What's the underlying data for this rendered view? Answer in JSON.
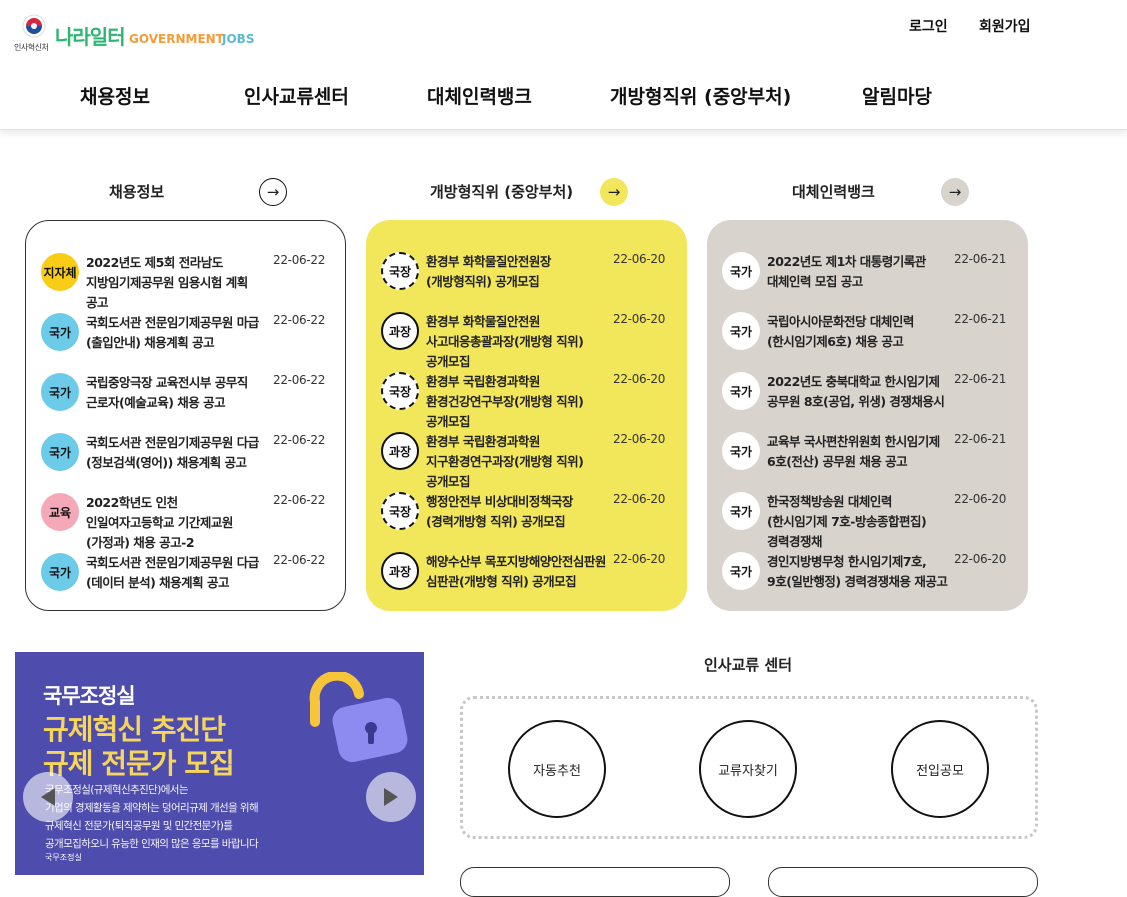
{
  "header": {
    "ministry": "인사혁신처",
    "logo_main": "나라일터",
    "logo_sub1": "GOVERNMENT",
    "logo_sub2": "JOBS",
    "login": "로그인",
    "signup": "회원가입",
    "nav": [
      "채용정보",
      "인사교류센터",
      "대체인력뱅크",
      "개방형직위 (중앙부처)",
      "알림마당"
    ]
  },
  "sections": {
    "recruit": {
      "title": "채용정보",
      "items": [
        {
          "badge": "지자체",
          "title": "2022년도 제5회 전라남도 지방임기제공무원 임용시험 계획 공고",
          "date": "22-06-22"
        },
        {
          "badge": "국가",
          "title": "국회도서관 전문임기제공무원 마급(출입안내) 채용계획 공고",
          "date": "22-06-22"
        },
        {
          "badge": "국가",
          "title": "국립중앙극장 교육전시부 공무직 근로자(예술교육) 채용 공고",
          "date": "22-06-22"
        },
        {
          "badge": "국가",
          "title": "국회도서관 전문임기제공무원 다급(정보검색(영어)) 채용계획 공고",
          "date": "22-06-22"
        },
        {
          "badge": "교육",
          "title": "2022학년도 인천 인일여자고등학교 기간제교원 (가정과) 채용 공고-2",
          "date": "22-06-22"
        },
        {
          "badge": "국가",
          "title": "국회도서관 전문임기제공무원 다급(데이터 분석) 채용계획 공고",
          "date": "22-06-22"
        }
      ]
    },
    "open": {
      "title": "개방형직위 (중앙부처)",
      "items": [
        {
          "badge": "국장",
          "title": "환경부 화학물질안전원장(개방형직위) 공개모집",
          "date": "22-06-20"
        },
        {
          "badge": "과장",
          "title": "환경부 화학물질안전원 사고대응총괄과장(개방형 직위) 공개모집",
          "date": "22-06-20"
        },
        {
          "badge": "국장",
          "title": "환경부 국립환경과학원 환경건강연구부장(개방형 직위) 공개모집",
          "date": "22-06-20"
        },
        {
          "badge": "과장",
          "title": "환경부 국립환경과학원 지구환경연구과장(개방형 직위) 공개모집",
          "date": "22-06-20"
        },
        {
          "badge": "국장",
          "title": "행정안전부 비상대비정책국장(경력개방형 직위) 공개모집",
          "date": "22-06-20"
        },
        {
          "badge": "과장",
          "title": "해양수산부 목포지방해양안전심판원 심판관(개방형 직위) 공개모집",
          "date": "22-06-20"
        }
      ]
    },
    "substitute": {
      "title": "대체인력뱅크",
      "items": [
        {
          "badge": "국가",
          "title": "2022년도 제1차 대통령기록관 대체인력 모집 공고",
          "date": "22-06-21"
        },
        {
          "badge": "국가",
          "title": "국립아시아문화전당 대체인력(한시임기제6호) 채용 공고",
          "date": "22-06-21"
        },
        {
          "badge": "국가",
          "title": "2022년도 충북대학교 한시임기제 공무원 8호(공업, 위생) 경쟁채용시",
          "date": "22-06-21"
        },
        {
          "badge": "국가",
          "title": "교육부 국사편찬위원회 한시임기제 6호(전산) 공무원 채용 공고",
          "date": "22-06-21"
        },
        {
          "badge": "국가",
          "title": "한국정책방송원 대체인력(한시임기제 7호-방송종합편집) 경력경쟁채",
          "date": "22-06-20"
        },
        {
          "badge": "국가",
          "title": "경인지방병무청 한시임기제7호, 9호(일반행정) 경력경쟁채용 재공고",
          "date": "22-06-20"
        }
      ]
    }
  },
  "banner": {
    "small": "국무조정실",
    "line1": "규제혁신 추진단",
    "line2": "규제 전문가 모집",
    "desc1": "국무조정실(규제혁신추진단)에서는",
    "desc2": "기업의 경제활동을 제약하는 덩어리규제 개선을 위해",
    "desc3": "규제혁신 전문가(퇴직공무원 및 민간전문가)를",
    "desc4": "공개모집하오니 유능한 인재의 많은 응모를 바랍니다",
    "foot": "국무조정실"
  },
  "exchange": {
    "title": "인사교류 센터",
    "buttons": [
      "자동추천",
      "교류자찾기",
      "전입공모"
    ]
  }
}
